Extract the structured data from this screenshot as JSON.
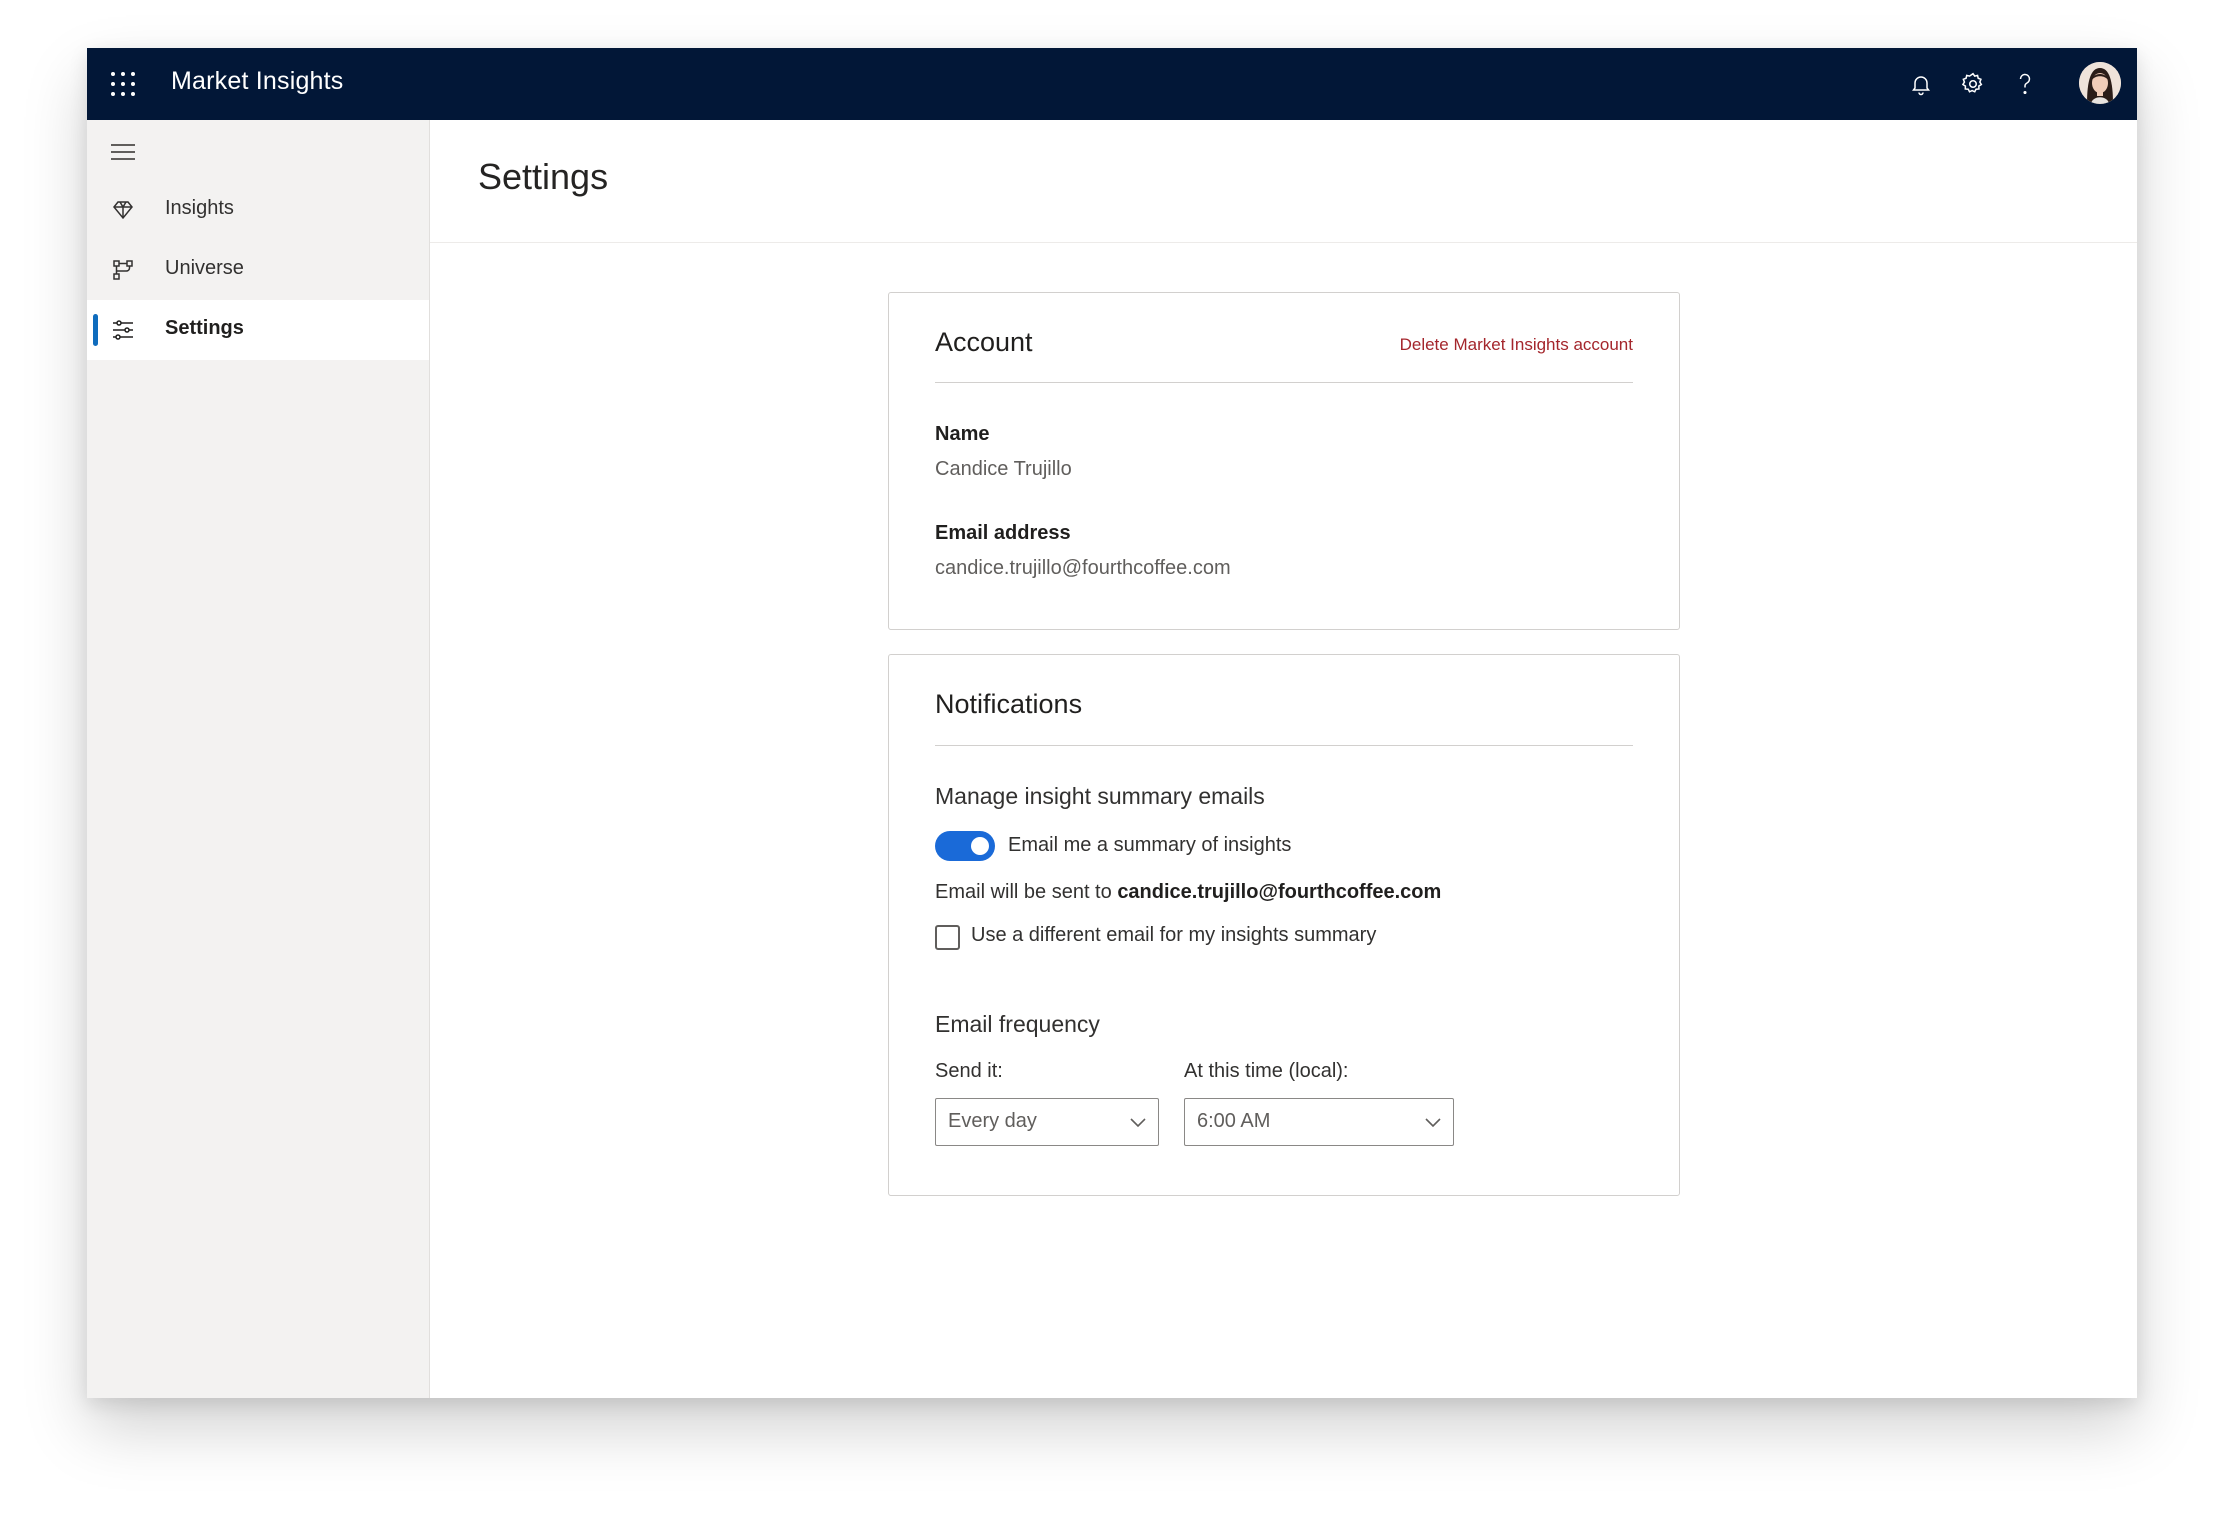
{
  "app": {
    "title": "Market Insights"
  },
  "header_icons": [
    "bell-icon",
    "gear-icon",
    "help-icon",
    "user-avatar"
  ],
  "sidebar": {
    "items": [
      {
        "label": "Insights",
        "icon": "diamond-icon",
        "active": false
      },
      {
        "label": "Universe",
        "icon": "hierarchy-icon",
        "active": false
      },
      {
        "label": "Settings",
        "icon": "sliders-icon",
        "active": true
      }
    ]
  },
  "page": {
    "title": "Settings"
  },
  "account": {
    "title": "Account",
    "delete_label": "Delete Market Insights account",
    "name_label": "Name",
    "name_value": "Candice Trujillo",
    "email_label": "Email address",
    "email_value": "candice.trujillo@fourthcoffee.com"
  },
  "notifications": {
    "title": "Notifications",
    "manage_heading": "Manage insight summary emails",
    "toggle_label": "Email me a summary of insights",
    "toggle_on": true,
    "sent_to_prefix": "Email will be sent to",
    "sent_to_email": "candice.trujillo@fourthcoffee.com",
    "checkbox_label": "Use a different email for my insights summary",
    "checkbox_checked": false,
    "frequency_heading": "Email frequency",
    "send_it_label": "Send it:",
    "send_it_value": "Every day",
    "time_label": "At this time (local):",
    "time_value": "6:00 AM"
  },
  "colors": {
    "topbar": "#021737",
    "accent": "#1a6ad8",
    "danger": "#a4262c",
    "sidebar_bg": "#f3f2f1"
  }
}
